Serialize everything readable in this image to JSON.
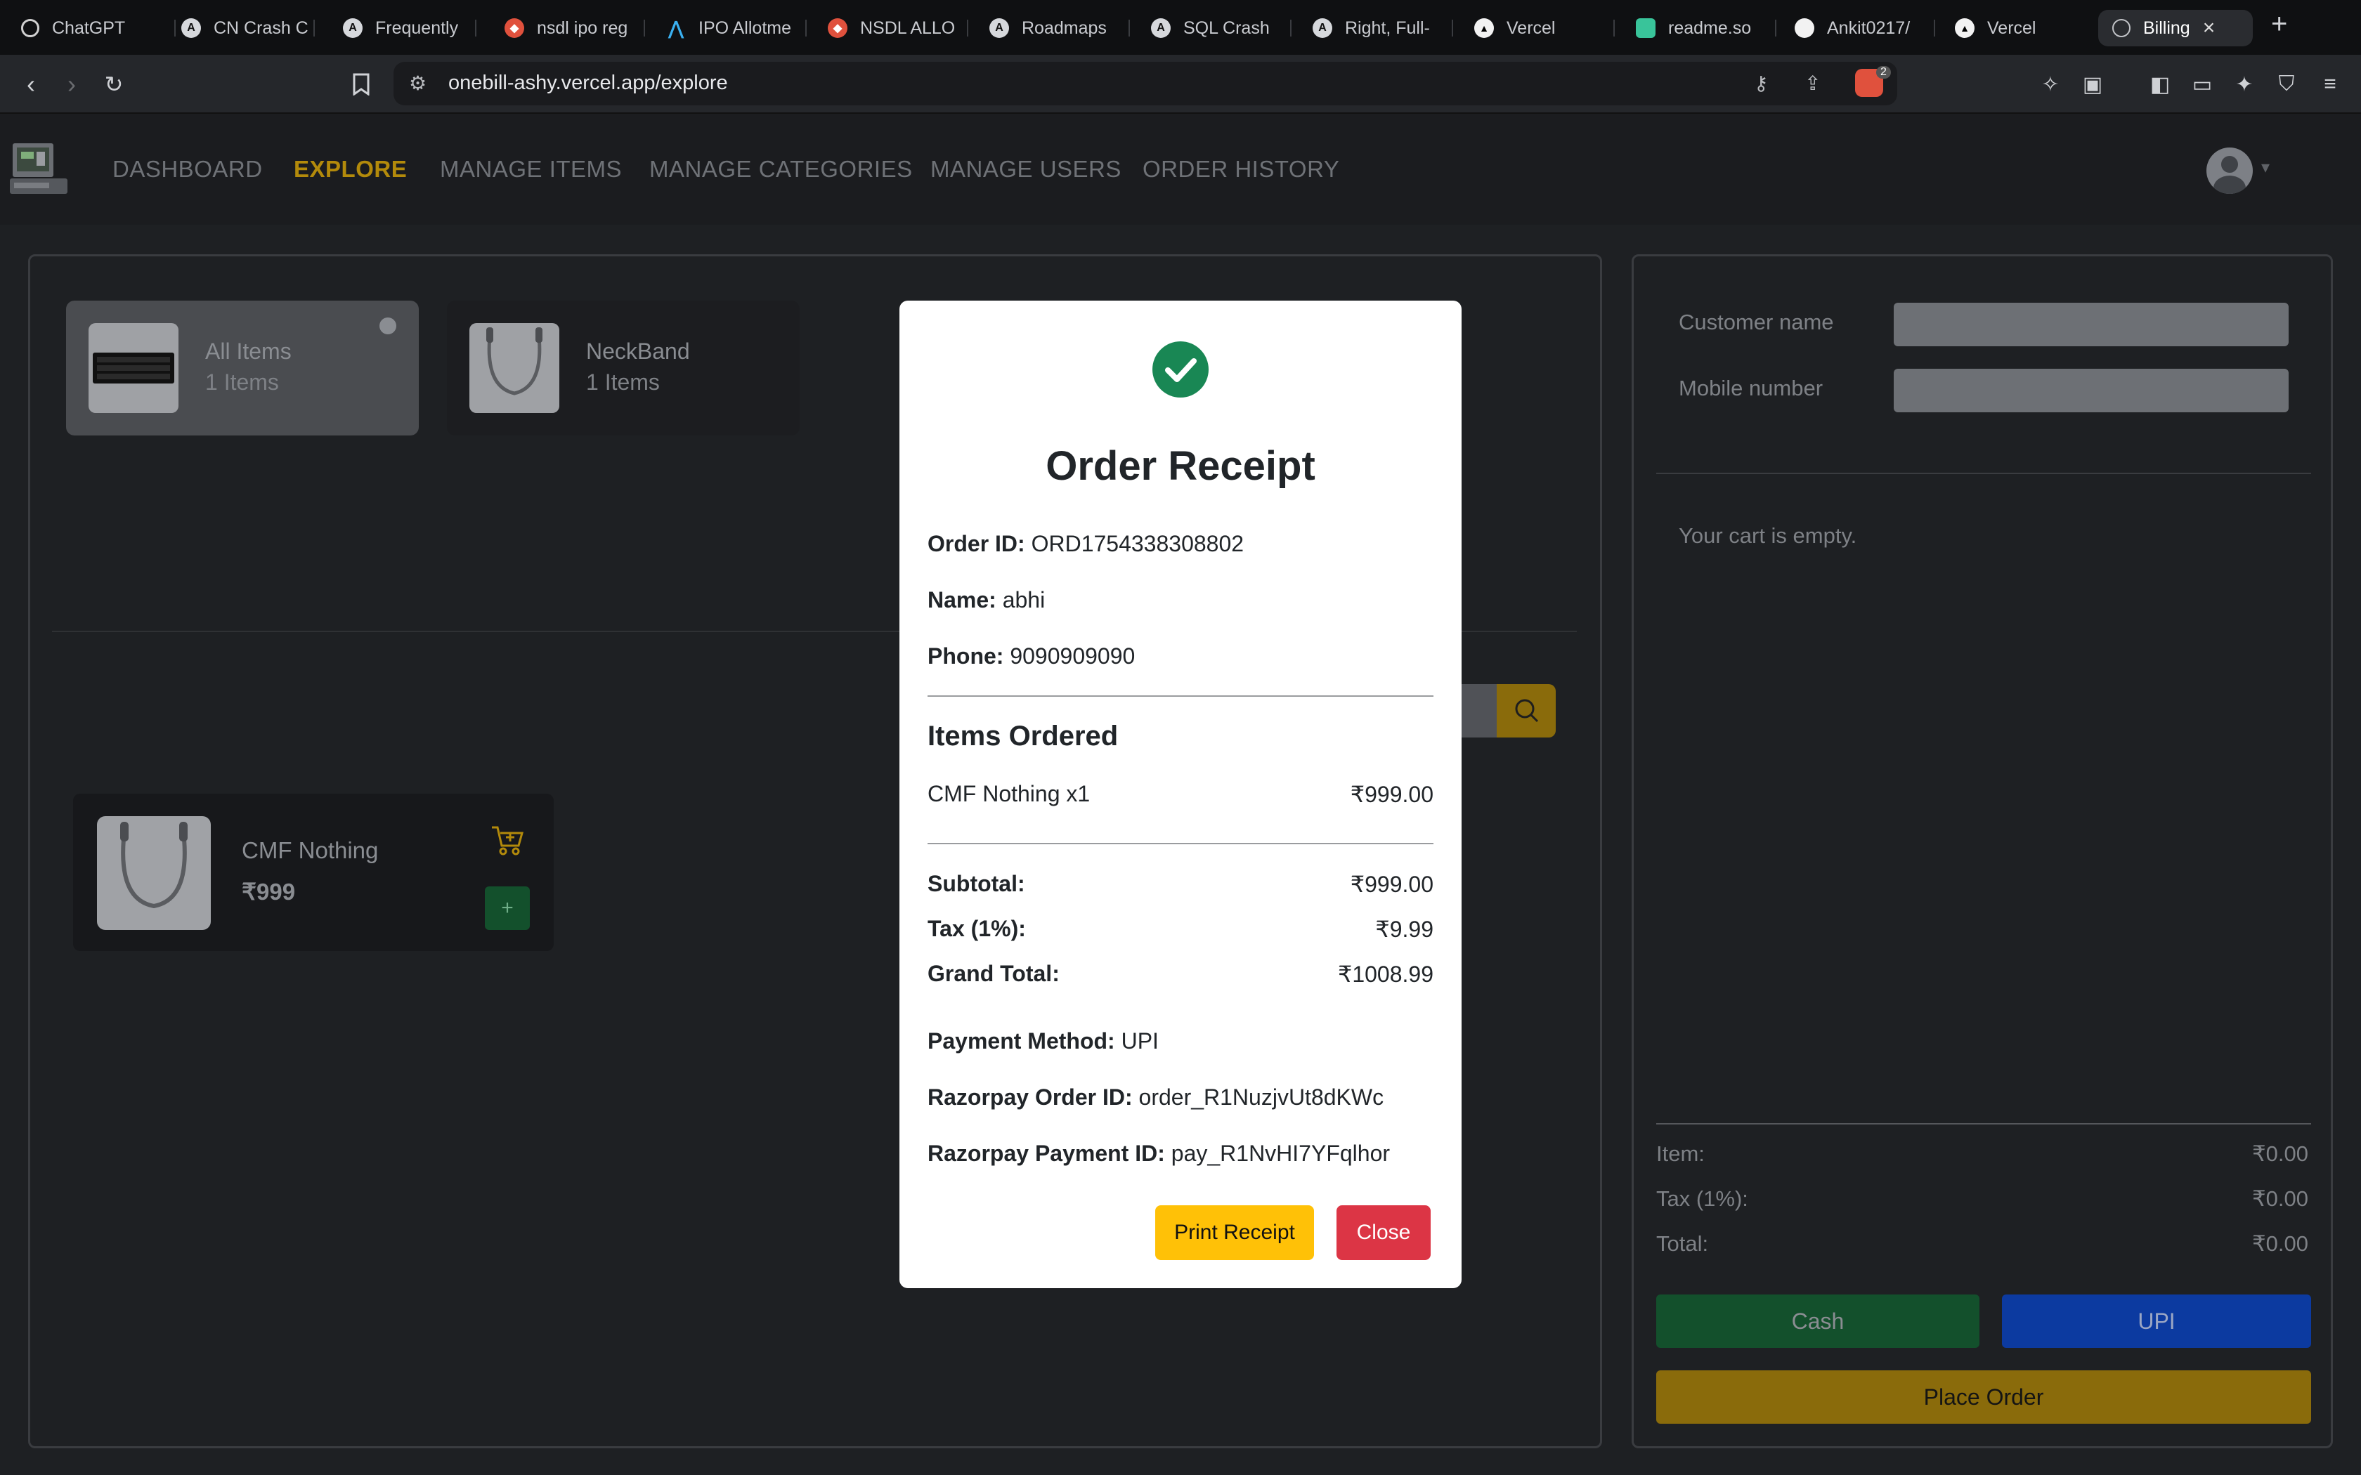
{
  "browser": {
    "tabs": [
      {
        "label": "ChatGPT",
        "icon": "chatgpt-icon"
      },
      {
        "label": "CN Crash C",
        "icon": "vercel-a-icon"
      },
      {
        "label": "Frequently",
        "icon": "vercel-a-icon"
      },
      {
        "label": "nsdl ipo reg",
        "icon": "brave-search-icon"
      },
      {
        "label": "IPO Allotme",
        "icon": "ipo-icon"
      },
      {
        "label": "NSDL ALLO",
        "icon": "brave-search-icon"
      },
      {
        "label": "Roadmaps",
        "icon": "vercel-a-icon"
      },
      {
        "label": "SQL Crash",
        "icon": "vercel-a-icon"
      },
      {
        "label": "Right, Full-",
        "icon": "vercel-a-icon"
      },
      {
        "label": "Vercel",
        "icon": "vercel-triangle-icon"
      },
      {
        "label": "readme.so",
        "icon": "readme-icon"
      },
      {
        "label": "Ankit0217/",
        "icon": "github-icon"
      },
      {
        "label": "Vercel",
        "icon": "vercel-triangle-icon"
      },
      {
        "label": "Billing",
        "icon": "globe-icon"
      }
    ],
    "url": "onebill-ashy.vercel.app/explore",
    "brave_badge": "2"
  },
  "nav": {
    "links": [
      "DASHBOARD",
      "EXPLORE",
      "MANAGE ITEMS",
      "MANAGE CATEGORIES",
      "MANAGE USERS",
      "ORDER HISTORY"
    ],
    "active": "EXPLORE"
  },
  "categories": [
    {
      "name": "All Items",
      "count": "1 Items"
    },
    {
      "name": "NeckBand",
      "count": "1 Items"
    }
  ],
  "items": [
    {
      "name": "CMF Nothing",
      "price": "₹999",
      "add_label": "+"
    }
  ],
  "cart": {
    "customer_label": "Customer name",
    "mobile_label": "Mobile number",
    "empty_text": "Your cart is empty.",
    "item_label": "Item:",
    "item_value": "₹0.00",
    "tax_label": "Tax (1%):",
    "tax_value": "₹0.00",
    "total_label": "Total:",
    "total_value": "₹0.00",
    "cash_label": "Cash",
    "upi_label": "UPI",
    "place_order_label": "Place Order"
  },
  "receipt": {
    "title": "Order Receipt",
    "order_id_label": "Order ID:",
    "order_id": "ORD1754338308802",
    "name_label": "Name:",
    "name": "abhi",
    "phone_label": "Phone:",
    "phone": "9090909090",
    "items_heading": "Items Ordered",
    "lines": [
      {
        "item": "CMF Nothing x1",
        "amount": "₹999.00"
      }
    ],
    "subtotal_label": "Subtotal:",
    "subtotal": "₹999.00",
    "tax_label": "Tax (1%):",
    "tax": "₹9.99",
    "grand_label": "Grand Total:",
    "grand_total": "₹1008.99",
    "payment_label": "Payment Method:",
    "payment_method": "UPI",
    "rzp_order_label": "Razorpay Order ID:",
    "rzp_order_id": "order_R1NuzjvUt8dKWc",
    "rzp_payment_label": "Razorpay Payment ID:",
    "rzp_payment_id": "pay_R1NvHI7YFqlhor",
    "print_label": "Print Receipt",
    "close_label": "Close"
  },
  "colors": {
    "accent": "#b38a0b",
    "success": "#198754",
    "danger": "#dc3545",
    "warning": "#ffc107",
    "upi_blue": "#0c3aa0",
    "cash_green": "#13502c"
  }
}
